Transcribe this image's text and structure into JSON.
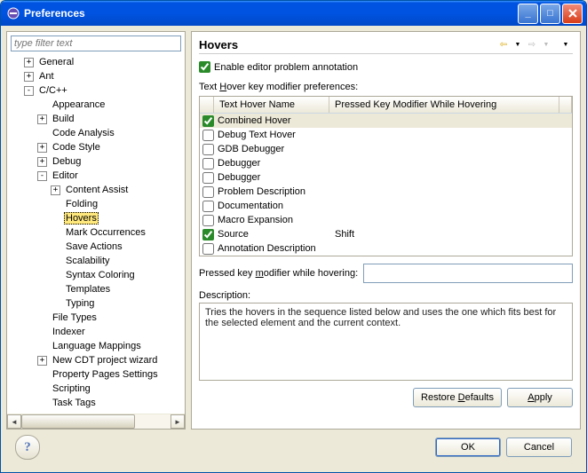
{
  "window": {
    "title": "Preferences"
  },
  "filter": {
    "placeholder": "type filter text"
  },
  "tree": {
    "general": "General",
    "ant": "Ant",
    "cpp": "C/C++",
    "appearance": "Appearance",
    "build": "Build",
    "code_analysis": "Code Analysis",
    "code_style": "Code Style",
    "debug": "Debug",
    "editor": "Editor",
    "content_assist": "Content Assist",
    "folding": "Folding",
    "hovers": "Hovers",
    "mark_occ": "Mark Occurrences",
    "save_actions": "Save Actions",
    "scalability": "Scalability",
    "syntax_coloring": "Syntax Coloring",
    "templates": "Templates",
    "typing": "Typing",
    "file_types": "File Types",
    "indexer": "Indexer",
    "lang_mappings": "Language Mappings",
    "new_cdt": "New CDT project wizard",
    "prop_pages": "Property Pages Settings",
    "scripting": "Scripting",
    "task_tags": "Task Tags"
  },
  "right": {
    "title": "Hovers",
    "enable_label": "Enable editor problem annotation",
    "section_label": "Text Hover key modifier preferences:",
    "col_name": "Text Hover Name",
    "col_key": "Pressed Key Modifier While Hovering",
    "rows": {
      "r0": {
        "name": "Combined Hover",
        "key": "",
        "checked": true,
        "sel": true
      },
      "r1": {
        "name": "Debug Text Hover",
        "key": "",
        "checked": false
      },
      "r2": {
        "name": "GDB Debugger",
        "key": "",
        "checked": false
      },
      "r3": {
        "name": "Debugger",
        "key": "",
        "checked": false
      },
      "r4": {
        "name": "Debugger",
        "key": "",
        "checked": false
      },
      "r5": {
        "name": "Problem Description",
        "key": "",
        "checked": false
      },
      "r6": {
        "name": "Documentation",
        "key": "",
        "checked": false
      },
      "r7": {
        "name": "Macro Expansion",
        "key": "",
        "checked": false
      },
      "r8": {
        "name": "Source",
        "key": "Shift",
        "checked": true
      },
      "r9": {
        "name": "Annotation Description",
        "key": "",
        "checked": false
      }
    },
    "pressed_label_pre": "Pressed key ",
    "pressed_label_under": "m",
    "pressed_label_post": "odifier while hovering:",
    "pressed_value": "",
    "desc_label": "Description:",
    "desc_text": "Tries the hovers in the sequence listed below and uses the one which fits best for the selected element and the current context.",
    "restore": "Restore Defaults",
    "apply": "Apply"
  },
  "footer": {
    "ok": "OK",
    "cancel": "Cancel"
  }
}
